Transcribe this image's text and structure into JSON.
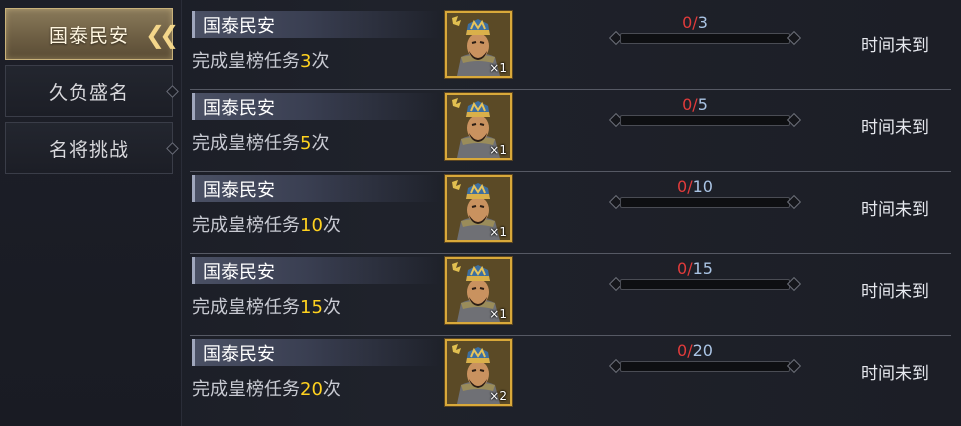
{
  "sidebar": {
    "tabs": [
      {
        "label": "国泰民安",
        "active": true
      },
      {
        "label": "久负盛名",
        "active": false
      },
      {
        "label": "名将挑战",
        "active": false
      }
    ]
  },
  "tasks": [
    {
      "title": "国泰民安",
      "desc_prefix": "完成皇榜任务",
      "count": "3",
      "desc_suffix": "次",
      "reward_qty": "×1",
      "progress_current": "0",
      "progress_sep": "/",
      "progress_goal": "3",
      "progress_fraction": 0,
      "status": "时间未到"
    },
    {
      "title": "国泰民安",
      "desc_prefix": "完成皇榜任务",
      "count": "5",
      "desc_suffix": "次",
      "reward_qty": "×1",
      "progress_current": "0",
      "progress_sep": "/",
      "progress_goal": "5",
      "progress_fraction": 0,
      "status": "时间未到"
    },
    {
      "title": "国泰民安",
      "desc_prefix": "完成皇榜任务",
      "count": "10",
      "desc_suffix": "次",
      "reward_qty": "×1",
      "progress_current": "0",
      "progress_sep": "/",
      "progress_goal": "10",
      "progress_fraction": 0,
      "status": "时间未到"
    },
    {
      "title": "国泰民安",
      "desc_prefix": "完成皇榜任务",
      "count": "15",
      "desc_suffix": "次",
      "reward_qty": "×1",
      "progress_current": "0",
      "progress_sep": "/",
      "progress_goal": "15",
      "progress_fraction": 0,
      "status": "时间未到"
    },
    {
      "title": "国泰民安",
      "desc_prefix": "完成皇榜任务",
      "count": "20",
      "desc_suffix": "次",
      "reward_qty": "×2",
      "progress_current": "0",
      "progress_sep": "/",
      "progress_goal": "20",
      "progress_fraction": 0,
      "status": "时间未到"
    }
  ],
  "colors": {
    "accent_gold": "#d9a93a",
    "count_yellow": "#ffd21f",
    "progress_red": "#e13b3b",
    "progress_blue": "#aac4e4"
  },
  "icons": {
    "reward": "general-portrait-icon",
    "tab_active": "double-chevron-left-icon",
    "tab_connector": "diamond-icon"
  }
}
